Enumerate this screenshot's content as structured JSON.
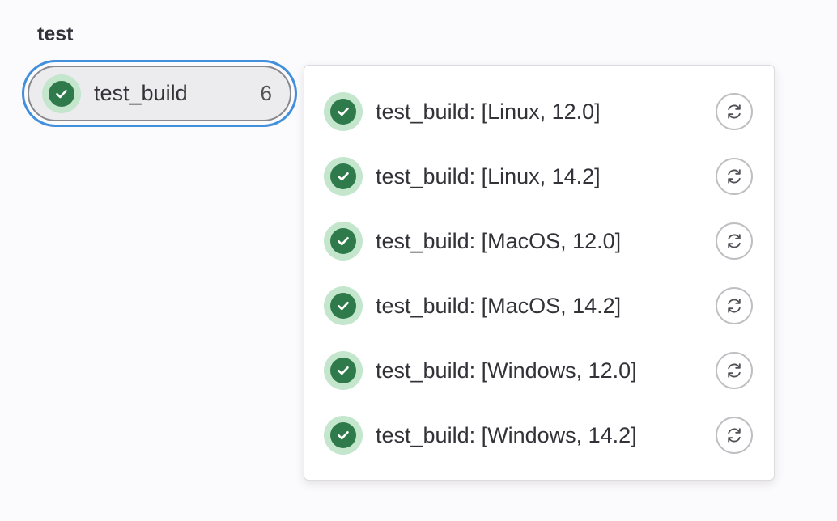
{
  "stage": {
    "title": "test"
  },
  "job": {
    "name": "test_build",
    "count": "6",
    "status": "success",
    "status_icon": "check-circle-icon"
  },
  "dropdown": {
    "items": [
      {
        "label": "test_build: [Linux, 12.0]",
        "status": "success",
        "action_icon": "retry-icon"
      },
      {
        "label": "test_build: [Linux, 14.2]",
        "status": "success",
        "action_icon": "retry-icon"
      },
      {
        "label": "test_build: [MacOS, 12.0]",
        "status": "success",
        "action_icon": "retry-icon"
      },
      {
        "label": "test_build: [MacOS, 14.2]",
        "status": "success",
        "action_icon": "retry-icon"
      },
      {
        "label": "test_build: [Windows, 12.0]",
        "status": "success",
        "action_icon": "retry-icon"
      },
      {
        "label": "test_build: [Windows, 14.2]",
        "status": "success",
        "action_icon": "retry-icon"
      }
    ]
  },
  "colors": {
    "success": "#2f7a4a",
    "success_bg": "#c3e6cd",
    "focus_ring": "#428fdc"
  }
}
